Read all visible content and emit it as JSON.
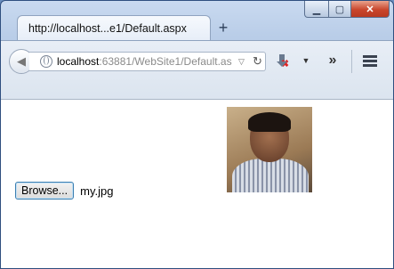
{
  "window": {
    "caption": {
      "minimize": "▁",
      "maximize": "▢",
      "close": "✕"
    }
  },
  "tab": {
    "title": "http://localhost...e1/Default.aspx",
    "new_tab": "+"
  },
  "toolbar": {
    "back_glyph": "◀",
    "url_host": "localhost",
    "url_rest": ":63881/WebSite1/Default.as",
    "url_dropdown": "▽",
    "reload_glyph": "↻",
    "download_x": "✖",
    "download_dropdown": "▼",
    "overflow_glyph": "»"
  },
  "page": {
    "browse_label": "Browse...",
    "selected_file": "my.jpg",
    "photo_alt": "uploaded photo"
  }
}
